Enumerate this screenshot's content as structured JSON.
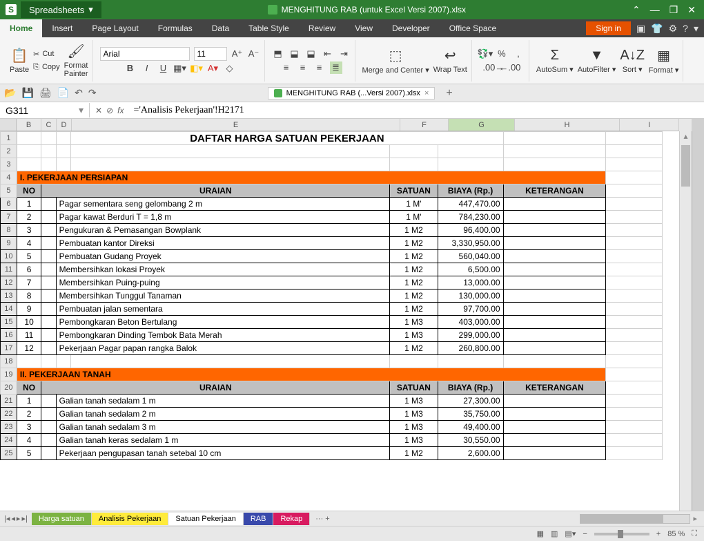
{
  "app": {
    "name": "Spreadsheets",
    "dropdown": "▾"
  },
  "title": "MENGHITUNG RAB (untuk Excel Versi 2007).xlsx",
  "window": {
    "min": "⌃",
    "restore": "❐",
    "close": "✕",
    "down": "—"
  },
  "menu": [
    "Home",
    "Insert",
    "Page Layout",
    "Formulas",
    "Data",
    "Table Style",
    "Review",
    "View",
    "Developer",
    "Office Space"
  ],
  "signin": "Sign in",
  "ribbon": {
    "paste": "Paste",
    "cut": "Cut",
    "copy": "Copy",
    "formatpainter": "Format\nPainter",
    "font": "Arial",
    "size": "11",
    "merge": "Merge and Center",
    "wrap": "Wrap Text",
    "autosum": "AutoSum",
    "autofilter": "AutoFilter",
    "sort": "Sort",
    "format": "Format"
  },
  "doctab": "MENGHITUNG RAB (...Versi 2007).xlsx",
  "namebox": "G311",
  "formula": "='Analisis Pekerjaan'!H2171",
  "cols": [
    "B",
    "C",
    "D",
    "E",
    "F",
    "G",
    "H",
    "I"
  ],
  "pagetitle": "DAFTAR HARGA SATUAN PEKERJAAN",
  "hdrs": {
    "no": "NO",
    "uraian": "URAIAN",
    "satuan": "SATUAN",
    "biaya": "BIAYA  (Rp.)",
    "ket": "KETERANGAN"
  },
  "sec1": {
    "title": "I.  PEKERJAAN PERSIAPAN",
    "rows": [
      {
        "rn": 6,
        "no": "1",
        "u": "Pagar sementara seng gelombang 2 m",
        "s": "1 M'",
        "b": "447,470.00"
      },
      {
        "rn": 7,
        "no": "2",
        "u": "Pagar kawat Berduri T = 1,8 m",
        "s": "1 M'",
        "b": "784,230.00"
      },
      {
        "rn": 8,
        "no": "3",
        "u": "Pengukuran & Pemasangan Bowplank",
        "s": "1 M2",
        "b": "96,400.00"
      },
      {
        "rn": 9,
        "no": "4",
        "u": "Pembuatan kantor Direksi",
        "s": "1 M2",
        "b": "3,330,950.00"
      },
      {
        "rn": 10,
        "no": "5",
        "u": "Pembuatan Gudang Proyek",
        "s": "1 M2",
        "b": "560,040.00"
      },
      {
        "rn": 11,
        "no": "6",
        "u": "Membersihkan lokasi Proyek",
        "s": "1 M2",
        "b": "6,500.00"
      },
      {
        "rn": 12,
        "no": "7",
        "u": "Membersihkan Puing-puing",
        "s": "1 M2",
        "b": "13,000.00"
      },
      {
        "rn": 13,
        "no": "8",
        "u": "Membersihkan Tunggul Tanaman",
        "s": "1 M2",
        "b": "130,000.00"
      },
      {
        "rn": 14,
        "no": "9",
        "u": "Pembuatan jalan sementara",
        "s": "1 M2",
        "b": "97,700.00"
      },
      {
        "rn": 15,
        "no": "10",
        "u": "Pembongkaran Beton Bertulang",
        "s": "1 M3",
        "b": "403,000.00"
      },
      {
        "rn": 16,
        "no": "11",
        "u": "Pembongkaran Dinding Tembok Bata Merah",
        "s": "1 M3",
        "b": "299,000.00"
      },
      {
        "rn": 17,
        "no": "12",
        "u": "Pekerjaan  Pagar papan rangka Balok",
        "s": "1 M2",
        "b": "260,800.00"
      }
    ]
  },
  "sec2": {
    "title": "II.  PEKERJAAN TANAH",
    "rows": [
      {
        "rn": 21,
        "no": "1",
        "u": "Galian tanah  sedalam 1 m",
        "s": "1 M3",
        "b": "27,300.00"
      },
      {
        "rn": 22,
        "no": "2",
        "u": "Galian tanah sedalam 2 m",
        "s": "1 M3",
        "b": "35,750.00"
      },
      {
        "rn": 23,
        "no": "3",
        "u": "Galian tanah sedalam 3 m",
        "s": "1 M3",
        "b": "49,400.00"
      },
      {
        "rn": 24,
        "no": "4",
        "u": "Galian tanah keras sedalam 1 m",
        "s": "1 M3",
        "b": "30,550.00"
      },
      {
        "rn": 25,
        "no": "5",
        "u": "Pekerjaan pengupasan tanah setebal 10 cm",
        "s": "1 M2",
        "b": "2,600.00"
      }
    ]
  },
  "sheets": [
    "Harga satuan",
    "Analisis Pekerjaan",
    "Satuan Pekerjaan",
    "RAB",
    "Rekap"
  ],
  "zoom": "85 %"
}
